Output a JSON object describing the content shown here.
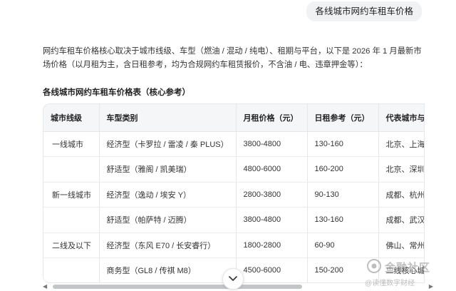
{
  "user_message": "各线城市网约车租车价格",
  "intro": "网约车租车价格核心取决于城市线级、车型（燃油 / 混动 / 纯电）、租期与平台，以下是 2026 年 1 月最新市场价格（以月租为主，含日租参考，均为合规网约车租赁报价，不含油 / 电、违章押金等）：",
  "section_title": "各线城市网约车租车价格表（核心参考）",
  "table": {
    "headers": [
      "城市线级",
      "车型类别",
      "月租价格（元）",
      "日租参考（元）",
      "代表城市与平台"
    ],
    "rows": [
      [
        "一线城市",
        "经济型（卡罗拉 / 雷凌 / 秦 PLUS）",
        "3800-4800",
        "130-160",
        "北京、上海"
      ],
      [
        "",
        "舒适型（雅阁 / 凯美瑞）",
        "4800-6000",
        "160-200",
        "北京、深圳"
      ],
      [
        "新一线城市",
        "经济型（逸动 / 埃安 Y）",
        "2800-3800",
        "90-130",
        "成都、杭州"
      ],
      [
        "",
        "舒适型（帕萨特 / 迈腾）",
        "3800-4800",
        "130-160",
        "成都、武汉"
      ],
      [
        "二线及以下",
        "经济型（东风 E70 / 长安睿行）",
        "1800-2800",
        "60-90",
        "佛山、常州"
      ],
      [
        "",
        "商务型（GL8 / 传祺 M8）",
        "4500-6000",
        "150-200",
        "二线核心城"
      ]
    ]
  },
  "watermark": {
    "line1": "金融社区",
    "line2": "@读懂数字财经"
  },
  "colors": {
    "bubble_bg": "#f1f2f4",
    "header_bg": "#f5f6f8",
    "border": "#e6e7ea"
  }
}
